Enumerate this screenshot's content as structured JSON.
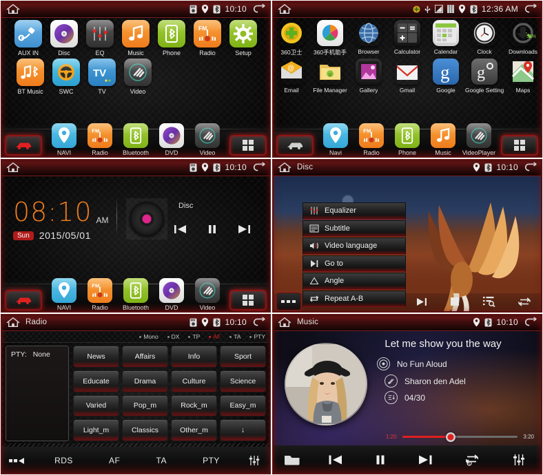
{
  "panels": {
    "home_apps": {
      "title": "",
      "status": {
        "time": "10:10",
        "icons": [
          "sd-card-icon",
          "location-icon",
          "bluetooth-icon"
        ]
      },
      "rows": [
        [
          {
            "label": "AUX IN",
            "icon": "aux-plug-icon"
          },
          {
            "label": "Disc",
            "icon": "disc-icon"
          },
          {
            "label": "EQ",
            "icon": "equalizer-icon"
          },
          {
            "label": "Music",
            "icon": "music-note-icon"
          },
          {
            "label": "Phone",
            "icon": "bluetooth-phone-icon"
          },
          {
            "label": "Radio",
            "icon": "fm-radio-icon"
          },
          {
            "label": "Setup",
            "icon": "gear-icon"
          }
        ],
        [
          {
            "label": "BT Music",
            "icon": "bluetooth-music-icon"
          },
          {
            "label": "SWC",
            "icon": "steering-wheel-icon"
          },
          {
            "label": "TV",
            "icon": "tv-icon"
          },
          {
            "label": "Video",
            "icon": "video-icon"
          }
        ]
      ],
      "dock": [
        {
          "label": "NAVI",
          "icon": "navi-pin-icon"
        },
        {
          "label": "Radio",
          "icon": "fm-radio-icon"
        },
        {
          "label": "Bluetooth",
          "icon": "bluetooth-icon"
        },
        {
          "label": "DVD",
          "icon": "disc-icon"
        },
        {
          "label": "Video",
          "icon": "video-icon"
        }
      ]
    },
    "android_apps": {
      "status": {
        "time": "12:36 AM",
        "icons": [
          "update-icon",
          "usb-icon",
          "screenshot-icon",
          "sim-icon",
          "location-icon",
          "bluetooth-icon"
        ]
      },
      "rows": [
        [
          {
            "label": "360卫士",
            "icon": "360-guard-icon"
          },
          {
            "label": "360手机助手",
            "icon": "360-assistant-icon"
          },
          {
            "label": "Browser",
            "icon": "browser-globe-icon"
          },
          {
            "label": "Calculator",
            "icon": "calculator-icon"
          },
          {
            "label": "Calendar",
            "icon": "calendar-icon"
          },
          {
            "label": "Clock",
            "icon": "clock-icon"
          },
          {
            "label": "Downloads",
            "icon": "downloads-icon",
            "badge": "36%"
          }
        ],
        [
          {
            "label": "Email",
            "icon": "email-icon"
          },
          {
            "label": "File Manager",
            "icon": "file-manager-icon"
          },
          {
            "label": "Gallery",
            "icon": "gallery-icon"
          },
          {
            "label": "Gmail",
            "icon": "gmail-icon"
          },
          {
            "label": "Google",
            "icon": "google-search-icon"
          },
          {
            "label": "Google Settings",
            "icon": "google-settings-icon"
          },
          {
            "label": "Maps",
            "icon": "maps-icon"
          }
        ]
      ],
      "dock": [
        {
          "label": "Navi",
          "icon": "navi-pin-icon"
        },
        {
          "label": "Radio",
          "icon": "fm-radio-icon"
        },
        {
          "label": "Phone",
          "icon": "bluetooth-phone-icon"
        },
        {
          "label": "Music",
          "icon": "music-note-icon"
        },
        {
          "label": "VideoPlayer",
          "icon": "video-icon"
        }
      ]
    },
    "clock_home": {
      "status": {
        "time": "10:10"
      },
      "clock": {
        "time": "08:10",
        "ampm": "AM",
        "day": "Sun",
        "date": "2015/05/01"
      },
      "now_playing": {
        "source": "Disc"
      },
      "controls": [
        "previous-track",
        "pause",
        "next-track"
      ],
      "dock": [
        {
          "label": "NAVI",
          "icon": "navi-pin-icon"
        },
        {
          "label": "Radio",
          "icon": "fm-radio-icon"
        },
        {
          "label": "Bluetooth",
          "icon": "bluetooth-icon"
        },
        {
          "label": "DVD",
          "icon": "disc-icon"
        },
        {
          "label": "Video",
          "icon": "video-icon"
        }
      ]
    },
    "disc_player": {
      "title": "Disc",
      "status": {
        "time": "10:10"
      },
      "menu": [
        {
          "label": "Equalizer",
          "icon": "equalizer-icon"
        },
        {
          "label": "Subtitle",
          "icon": "subtitle-icon"
        },
        {
          "label": "Video language",
          "icon": "audio-language-icon"
        },
        {
          "label": "Go to",
          "icon": "goto-icon"
        },
        {
          "label": "Angle",
          "icon": "angle-icon"
        },
        {
          "label": "Repeat A-B",
          "icon": "repeat-ab-icon"
        }
      ],
      "bottom": [
        "more-dots-icon",
        "next-track-icon",
        "stop-icon",
        "browse-icon",
        "repeat-icon"
      ]
    },
    "radio": {
      "title": "Radio",
      "status": {
        "time": "10:10"
      },
      "indicators": [
        {
          "label": "Mono",
          "active": false
        },
        {
          "label": "DX",
          "active": false
        },
        {
          "label": "TP",
          "active": false
        },
        {
          "label": "AF",
          "active": true
        },
        {
          "label": "TA",
          "active": false
        },
        {
          "label": "PTY",
          "active": false
        }
      ],
      "pty_label": "PTY:",
      "pty_value": "None",
      "pty_buttons": [
        "News",
        "Affairs",
        "Info",
        "Sport",
        "Educate",
        "Drama",
        "Culture",
        "Science",
        "Varied",
        "Pop_m",
        "Rock_m",
        "Easy_m",
        "Light_m",
        "Classics",
        "Other_m",
        "↓"
      ],
      "tabs": [
        "RDS",
        "AF",
        "TA",
        "PTY"
      ]
    },
    "music": {
      "title": "Music",
      "status": {
        "time": "10:10"
      },
      "song_title": "Let me show you the way",
      "album": "No Fun Aloud",
      "artist": "Sharon den Adel",
      "track_index": "04/30",
      "progress": {
        "current": "1:20",
        "total": "3:20",
        "percent": 42
      },
      "controls": [
        "folder-icon",
        "previous-track-icon",
        "pause-icon",
        "next-track-icon",
        "repeat-one-icon",
        "equalizer-icon"
      ]
    }
  },
  "colors": {
    "accent_red": "#b01b1b",
    "accent_orange": "#ef7c1c",
    "status_active": "#e02020",
    "text": "#e8e8e8"
  }
}
